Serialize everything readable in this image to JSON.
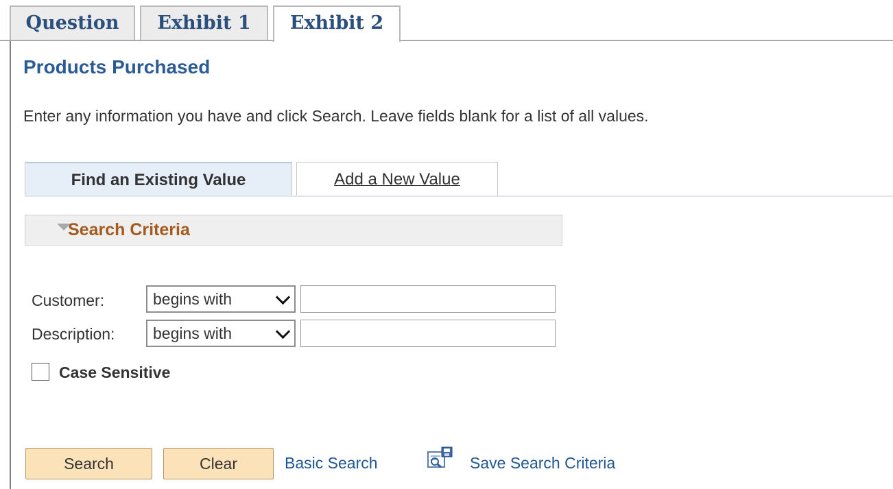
{
  "exam_tabs": [
    {
      "label": "Question"
    },
    {
      "label": "Exhibit 1"
    },
    {
      "label": "Exhibit 2"
    }
  ],
  "page": {
    "title": "Products Purchased",
    "instructions": "Enter any information you have and click Search. Leave fields blank for a list of all values."
  },
  "sub_tabs": {
    "find": "Find an Existing Value",
    "add": "Add a New Value"
  },
  "criteria": {
    "title": "Search Criteria"
  },
  "fields": {
    "customer": {
      "label": "Customer:",
      "operator": "begins with",
      "value": ""
    },
    "description": {
      "label": "Description:",
      "operator": "begins with",
      "value": ""
    }
  },
  "case_sensitive": {
    "label": "Case Sensitive",
    "checked": false
  },
  "actions": {
    "search": "Search",
    "clear": "Clear",
    "basic_search": "Basic Search",
    "save_criteria": "Save Search Criteria"
  },
  "colors": {
    "accent_title": "#2b5b95",
    "criteria_title": "#a55a1e",
    "button_bg": "#fbe2b9",
    "link": "#1f5692"
  }
}
